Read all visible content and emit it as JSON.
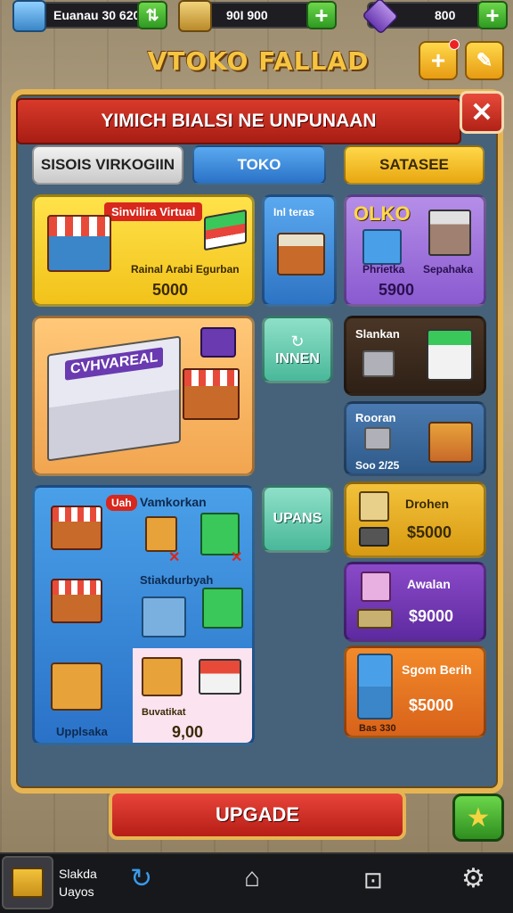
{
  "topbar": {
    "resource1": {
      "value": "Euanau 30 620"
    },
    "resource2": {
      "value": "90I 900"
    },
    "resource3": {
      "value": "800"
    }
  },
  "title": "VTOKO FALLAD",
  "panel": {
    "header": "YIMICH BIALSI NE UNPUNAAN",
    "tabs": [
      "SISOIS VIRKOGIIN",
      "TOKO",
      "SATASEE"
    ]
  },
  "cards": {
    "store_virtual": {
      "badge": "Sinvilira Virtual",
      "caption": "Rainal Arabi Egurban",
      "price": "5000"
    },
    "interas": {
      "title": "Inl teras"
    },
    "olko": {
      "title": "OLKO",
      "item1": "Phrietka",
      "item2": "Sepahaka",
      "price": "5900"
    },
    "diorama": {
      "sign": "CVHVAREAL"
    },
    "innen": {
      "label": "INNEN"
    },
    "slankan": {
      "title": "Slankan"
    },
    "rooran": {
      "title": "Rooran",
      "caption": "Soo 2/25"
    },
    "vamkorkan": {
      "badge": "Uah",
      "title": "Vamkorkan",
      "mid": "Stiakdurbyah",
      "label1": "Upplsaka",
      "label2": "Buvatikat",
      "price": "9,00"
    },
    "upans": {
      "label": "UPANS"
    },
    "drohen": {
      "title": "Drohen",
      "price": "$5000"
    },
    "awalan": {
      "title": "Awalan",
      "price": "$9000"
    },
    "sgom": {
      "title": "Sgom Berih",
      "caption": "Bas 330",
      "price": "$5000"
    }
  },
  "upgrade_label": "UPGADE",
  "navbar": {
    "profile_line1": "Slakda",
    "profile_line2": "Uayos"
  },
  "colors": {
    "panel": "#46627a",
    "gold": "#e6b552",
    "red": "#c42a1e",
    "green": "#3aa82a"
  }
}
